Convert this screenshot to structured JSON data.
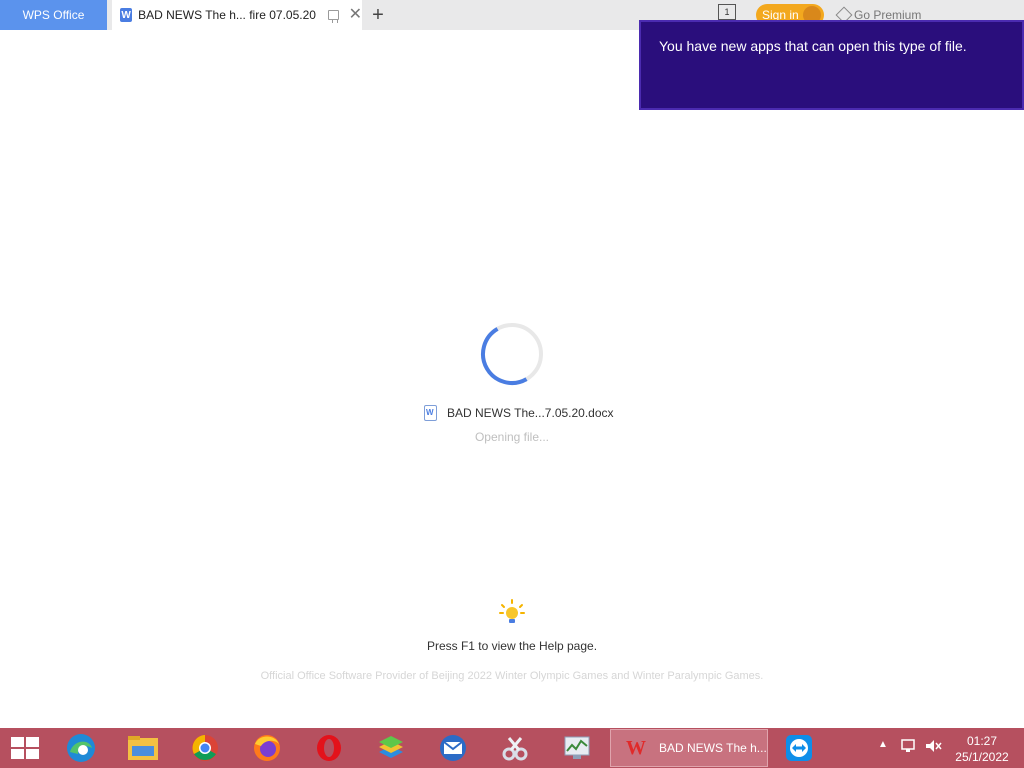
{
  "titlebar": {
    "home_tab": "WPS Office",
    "doc_tab_title": "BAD NEWS The h... fire 07.05.20",
    "doc_tab_icon": "word-doc-icon",
    "layout_badge": "1",
    "signin_label": "Sign in",
    "premium_label": "Go Premium"
  },
  "toast": {
    "message": "You have new apps that can open this type of file."
  },
  "loading": {
    "file_name": "BAD NEWS The...7.05.20.docx",
    "status": "Opening file...",
    "help_text": "Press F1 to view the Help page.",
    "provider_text": "Official Office Software Provider of Beijing 2022 Winter Olympic Games and Winter Paralympic Games."
  },
  "taskbar": {
    "apps": [
      "edge-icon",
      "file-explorer-icon",
      "chrome-icon",
      "firefox-icon",
      "opera-icon",
      "bluestacks-icon",
      "outlook-icon",
      "snipping-tool-icon",
      "resource-monitor-icon",
      "teamviewer-icon"
    ],
    "active_app_label": "BAD NEWS The h...",
    "time": "01:27",
    "date": "25/1/2022"
  },
  "colors": {
    "wps_tab": "#5b93ed",
    "toast_bg": "#2a0e7c",
    "taskbar_bg": "#b6505f",
    "spinner": "#4a7de2",
    "signin_bg": "#f3a81e"
  }
}
